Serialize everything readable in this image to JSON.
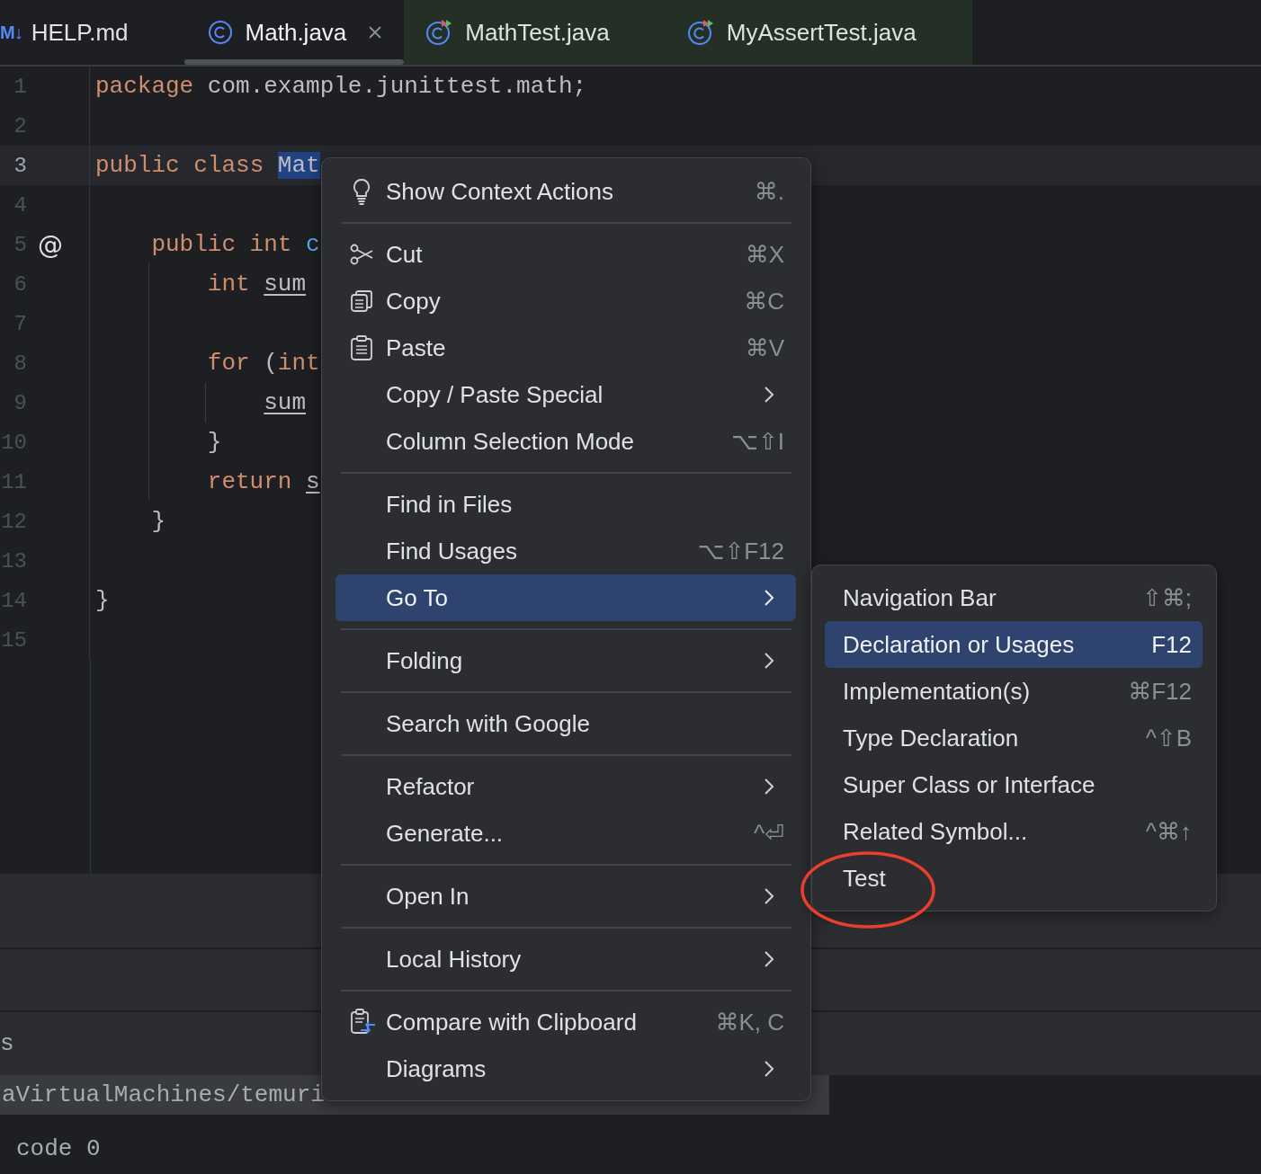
{
  "tabs": [
    {
      "badge": "M↓",
      "label": "HELP.md",
      "kind": "markdown",
      "selected": false,
      "tinted": false
    },
    {
      "label": "Math.java",
      "kind": "class",
      "selected": true,
      "tinted": false,
      "closable": true
    },
    {
      "label": "MathTest.java",
      "kind": "test",
      "selected": false,
      "tinted": true
    },
    {
      "label": "MyAssertTest.java",
      "kind": "test",
      "selected": false,
      "tinted": true
    }
  ],
  "editor": {
    "lines": [
      {
        "number": "1",
        "tokens": [
          {
            "kind": "keyword",
            "text": "package"
          },
          {
            "kind": "plain",
            "text": " com.example.junittest.math;"
          }
        ]
      },
      {
        "number": "2"
      },
      {
        "number": "3",
        "current": true,
        "tokens": [
          {
            "kind": "keyword",
            "text": "public class "
          },
          {
            "kind": "selection",
            "text": "Mat"
          }
        ]
      },
      {
        "number": "4"
      },
      {
        "number": "5",
        "gutter_icon": "@",
        "tokens": [
          {
            "kind": "keyword",
            "text": "    public int "
          },
          {
            "kind": "method",
            "text": "c"
          }
        ]
      },
      {
        "number": "6",
        "tokens": [
          {
            "kind": "keyword",
            "text": "        int "
          },
          {
            "kind": "variable",
            "text": "sum"
          }
        ]
      },
      {
        "number": "7"
      },
      {
        "number": "8",
        "tokens": [
          {
            "kind": "keyword",
            "text": "        for "
          },
          {
            "kind": "plain",
            "text": "("
          },
          {
            "kind": "keyword",
            "text": "int"
          }
        ]
      },
      {
        "number": "9",
        "tokens": [
          {
            "kind": "variable",
            "text": "            sum"
          }
        ]
      },
      {
        "number": "10",
        "tokens": [
          {
            "kind": "plain",
            "text": "        }"
          }
        ]
      },
      {
        "number": "11",
        "tokens": [
          {
            "kind": "keyword",
            "text": "        return "
          },
          {
            "kind": "variable",
            "text": "s"
          }
        ]
      },
      {
        "number": "12",
        "tokens": [
          {
            "kind": "plain",
            "text": "    }"
          }
        ]
      },
      {
        "number": "13"
      },
      {
        "number": "14",
        "tokens": [
          {
            "kind": "plain",
            "text": "}"
          }
        ]
      },
      {
        "number": "15"
      }
    ]
  },
  "bottom_panel": {
    "header_text": "s",
    "console_lines": [
      {
        "text": "aVirtualMachines/temuri",
        "highlighted": true
      },
      {
        "text": "code 0",
        "highlighted": false
      }
    ]
  },
  "menu": {
    "items": [
      {
        "kind": "item",
        "label": "Show Context Actions",
        "shortcut": "⌘.",
        "submenu": false,
        "selected": false
      },
      {
        "kind": "separator"
      },
      {
        "kind": "item",
        "label": "Cut",
        "shortcut": "⌘X",
        "submenu": false,
        "selected": false
      },
      {
        "kind": "item",
        "label": "Copy",
        "shortcut": "⌘C",
        "submenu": false,
        "selected": false
      },
      {
        "kind": "item",
        "label": "Paste",
        "shortcut": "⌘V",
        "submenu": false,
        "selected": false
      },
      {
        "kind": "item",
        "label": "Copy / Paste Special",
        "submenu": true,
        "selected": false
      },
      {
        "kind": "item",
        "label": "Column Selection Mode",
        "shortcut": "⌥⇧I",
        "submenu": false,
        "selected": false
      },
      {
        "kind": "separator"
      },
      {
        "kind": "item",
        "label": "Find in Files",
        "submenu": false,
        "selected": false
      },
      {
        "kind": "item",
        "label": "Find Usages",
        "shortcut": "⌥⇧F12",
        "submenu": false,
        "selected": false
      },
      {
        "kind": "item",
        "label": "Go To",
        "submenu": true,
        "selected": true
      },
      {
        "kind": "separator"
      },
      {
        "kind": "item",
        "label": "Folding",
        "submenu": true,
        "selected": false
      },
      {
        "kind": "separator"
      },
      {
        "kind": "item",
        "label": "Search with Google",
        "submenu": false,
        "selected": false
      },
      {
        "kind": "separator"
      },
      {
        "kind": "item",
        "label": "Refactor",
        "submenu": true,
        "selected": false
      },
      {
        "kind": "item",
        "label": "Generate...",
        "shortcut": "^⏎",
        "submenu": false,
        "selected": false
      },
      {
        "kind": "separator"
      },
      {
        "kind": "item",
        "label": "Open In",
        "submenu": true,
        "selected": false
      },
      {
        "kind": "separator"
      },
      {
        "kind": "item",
        "label": "Local History",
        "submenu": true,
        "selected": false
      },
      {
        "kind": "separator"
      },
      {
        "kind": "item",
        "label": "Compare with Clipboard",
        "shortcut": "⌘K, C",
        "submenu": false,
        "selected": false
      },
      {
        "kind": "item",
        "label": "Diagrams",
        "submenu": true,
        "selected": false
      }
    ]
  },
  "submenu": {
    "items": [
      {
        "kind": "item",
        "label": "Navigation Bar",
        "shortcut": "⇧⌘;",
        "selected": false,
        "circled": false
      },
      {
        "kind": "item",
        "label": "Declaration or Usages",
        "shortcut": "F12",
        "selected": true,
        "circled": false
      },
      {
        "kind": "item",
        "label": "Implementation(s)",
        "shortcut": "⌘F12",
        "selected": false,
        "circled": false
      },
      {
        "kind": "item",
        "label": "Type Declaration",
        "shortcut": "^⇧B",
        "selected": false,
        "circled": false
      },
      {
        "kind": "item",
        "label": "Super Class or Interface",
        "selected": false,
        "circled": false
      },
      {
        "kind": "item",
        "label": "Related Symbol...",
        "shortcut": "^⌘↑",
        "selected": false,
        "circled": false
      },
      {
        "kind": "item",
        "label": "Test",
        "selected": false,
        "circled": true
      }
    ]
  }
}
